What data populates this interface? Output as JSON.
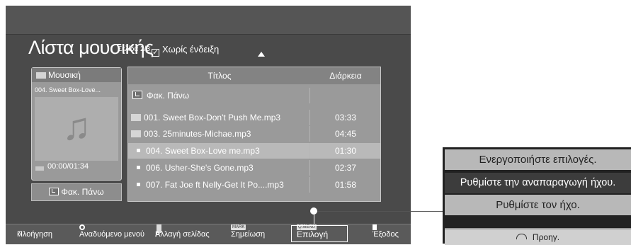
{
  "header": {
    "title": "Λίστα μουσικής",
    "page_info": "Σελίδα 2/3",
    "checkbox_mark": "✓",
    "no_hint_label": "Χωρίς ένδειξη"
  },
  "preview": {
    "folder_label": "Μουσική",
    "song": "004. Sweet Box-Love...",
    "time": "00:00/01:34",
    "up_button": "Φακ. Πάνω"
  },
  "list": {
    "col_title": "Τίτλος",
    "col_duration": "Διάρκεια",
    "rows": [
      {
        "name": "Φακ. Πάνω",
        "duration": ""
      },
      {
        "name": "001. Sweet Box-Don't Push Me.mp3",
        "duration": "03:33"
      },
      {
        "name": "003. 25minutes-Michae.mp3",
        "duration": "04:45"
      },
      {
        "name": "004. Sweet Box-Love me.mp3",
        "duration": "01:30"
      },
      {
        "name": "006. Usher-She's Gone.mp3",
        "duration": "02:37"
      },
      {
        "name": "007. Fat Joe ft Nelly-Get It Po....mp3",
        "duration": "01:58"
      }
    ]
  },
  "footer": {
    "navigation": "Πλοήγηση",
    "popup_menu": "Αναδυόμενο μενού",
    "p_key": "P",
    "page_change": "Αλλαγή σελίδας",
    "mark_key": "MARK",
    "mark": "Σημείωση",
    "menu_key": "Q.MENU",
    "option": "Επιλογή",
    "exit": "Έξοδος"
  },
  "menu": {
    "items": [
      "Ενεργοποιήστε επιλογές.",
      "Ρυθμίστε την αναπαραγωγή ήχου.",
      "Ρυθμίστε τον ήχο.",
      "Προηγ."
    ]
  }
}
